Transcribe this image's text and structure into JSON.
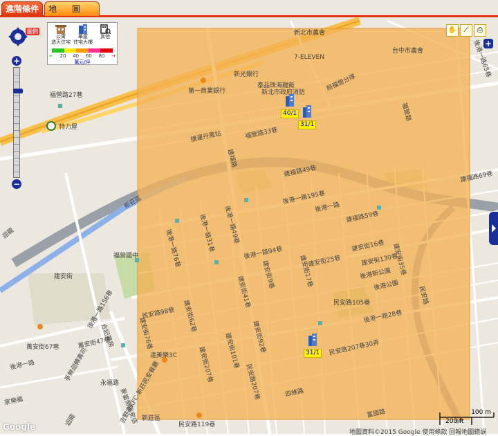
{
  "tabs": [
    {
      "label": "進階條件",
      "active": true
    },
    {
      "label": "地圖",
      "active": false
    }
  ],
  "legend": {
    "badge": "圖例",
    "categories": [
      {
        "label": "公寓\n透天住宅",
        "icon": "apartment-icon"
      },
      {
        "label": "華廈\n住宅大樓",
        "icon": "tower-icon"
      },
      {
        "label": "其他",
        "icon": "other-building-icon"
      }
    ],
    "ticks": [
      "20",
      "40",
      "60",
      "80"
    ],
    "unit": "萬元/坪",
    "colors": [
      "#28c828",
      "#ffe600",
      "#ff9a00",
      "#ff2c96",
      "#e00000"
    ]
  },
  "tools": [
    {
      "icon": "hand-pan-icon",
      "glyph": "✋"
    },
    {
      "icon": "measure-ruler-icon",
      "glyph": "⟋"
    },
    {
      "icon": "print-icon",
      "glyph": "⎙"
    }
  ],
  "zoom": {
    "in": "+",
    "out": "−"
  },
  "right_plus": "+",
  "selection": {
    "fill": "#f4b256"
  },
  "markers": [
    {
      "price": "40/1"
    },
    {
      "price": "31/1"
    },
    {
      "price": "31/1"
    }
  ],
  "map_labels": [
    "新北市農會",
    "台中市農會",
    "7-ELEVEN",
    "新光銀行",
    "第一商業銀行",
    "泰品珠海雞飯",
    "新北市政府消防",
    "局福營分隊",
    "福營路",
    "福營路27巷",
    "特力屋",
    "捷運丹鳳站",
    "福營路33巷",
    "建福路",
    "建福路49巷",
    "後港一路195巷",
    "後港一路",
    "建福路59巷",
    "建福路69巷",
    "後港一路65巷",
    "後港一路49巷",
    "後港一路31巷",
    "後港一路76巷",
    "後港一路94巷",
    "建安街9巷",
    "建安街17巷",
    "建安街16巷",
    "建安街130巷",
    "建安街25巷",
    "建安街35巷",
    "後港新公園",
    "後港公園",
    "福營國中",
    "民安路105巷",
    "建安街",
    "民安路98巷",
    "建安街41巷",
    "後港一路156巷",
    "後港一路28巷",
    "民安路",
    "建安街62巷",
    "建安街76巷",
    "建安街92巷",
    "建安街101巷",
    "建安街207巷",
    "民安路207巷",
    "民安路207巷30弄",
    "四維路",
    "富國路",
    "合記藥房",
    "萬安街47巷",
    "萬安街67巷",
    "後港一路",
    "家樂福",
    "爭鮮迴轉壽司",
    "吉野家KFC-新莊民安餐廳",
    "達美樂3C",
    "民安路119巷",
    "永福路",
    "麥當勞民安店",
    "迴龍",
    "新莊區"
  ],
  "scale": {
    "top": "100 m",
    "bottom": "200 ft"
  },
  "credits": "地圖資料©2015 Google  使用條款  回報地圖錯誤",
  "google_logo": "Google"
}
